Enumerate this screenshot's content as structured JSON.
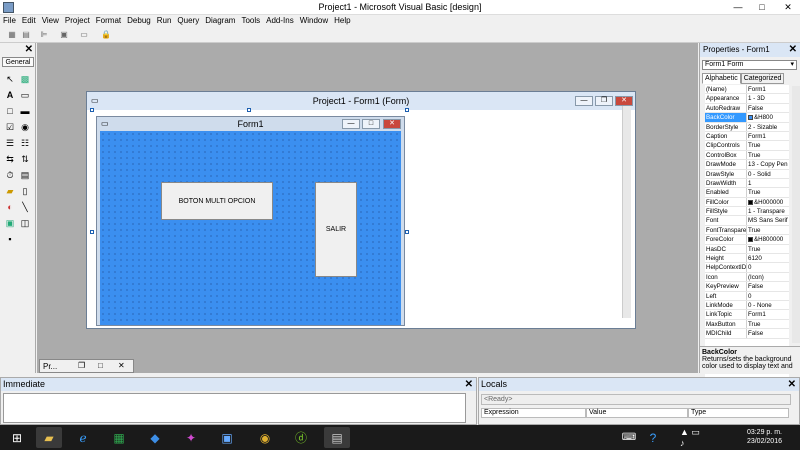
{
  "window": {
    "title": "Project1 - Microsoft Visual Basic [design]",
    "min": "—",
    "max": "□",
    "close": "✕"
  },
  "menu": [
    "File",
    "Edit",
    "View",
    "Project",
    "Format",
    "Debug",
    "Run",
    "Query",
    "Diagram",
    "Tools",
    "Add-Ins",
    "Window",
    "Help"
  ],
  "toolbox": {
    "close": "✕",
    "tab_label": "General"
  },
  "mdi_window": {
    "title": "Project1 - Form1 (Form)"
  },
  "form": {
    "caption": "Form1",
    "buttons": {
      "multi": "BOTON MULTI OPCION",
      "exit": "SALIR"
    }
  },
  "project_tab": {
    "label": "Pr..."
  },
  "properties": {
    "title": "Properties - Form1",
    "close": "✕",
    "object": "Form1  Form",
    "tabs": [
      "Alphabetic",
      "Categorized"
    ],
    "rows": [
      {
        "name": "(Name)",
        "value": "Form1"
      },
      {
        "name": "Appearance",
        "value": "1 - 3D"
      },
      {
        "name": "AutoRedraw",
        "value": "False"
      },
      {
        "name": "BackColor",
        "value": "&H800",
        "swatch": "#3b8ff0",
        "selected": true
      },
      {
        "name": "BorderStyle",
        "value": "2 - Sizable"
      },
      {
        "name": "Caption",
        "value": "Form1"
      },
      {
        "name": "ClipControls",
        "value": "True"
      },
      {
        "name": "ControlBox",
        "value": "True"
      },
      {
        "name": "DrawMode",
        "value": "13 - Copy Pen"
      },
      {
        "name": "DrawStyle",
        "value": "0 - Solid"
      },
      {
        "name": "DrawWidth",
        "value": "1"
      },
      {
        "name": "Enabled",
        "value": "True"
      },
      {
        "name": "FillColor",
        "value": "&H000000",
        "swatch": "#000000"
      },
      {
        "name": "FillStyle",
        "value": "1 - Transpare"
      },
      {
        "name": "Font",
        "value": "MS Sans Serif"
      },
      {
        "name": "FontTranspare",
        "value": "True"
      },
      {
        "name": "ForeColor",
        "value": "&H800000",
        "swatch": "#000000"
      },
      {
        "name": "HasDC",
        "value": "True"
      },
      {
        "name": "Height",
        "value": "6120"
      },
      {
        "name": "HelpContextID",
        "value": "0"
      },
      {
        "name": "Icon",
        "value": "(Icon)"
      },
      {
        "name": "KeyPreview",
        "value": "False"
      },
      {
        "name": "Left",
        "value": "0"
      },
      {
        "name": "LinkMode",
        "value": "0 - None"
      },
      {
        "name": "LinkTopic",
        "value": "Form1"
      },
      {
        "name": "MaxButton",
        "value": "True"
      },
      {
        "name": "MDIChild",
        "value": "False"
      }
    ],
    "desc_title": "BackColor",
    "desc_text": "Returns/sets the background color used to display text and"
  },
  "immediate": {
    "title": "Immediate",
    "close": "✕"
  },
  "locals": {
    "title": "Locals",
    "close": "✕",
    "status": "<Ready>",
    "columns": [
      "Expression",
      "Value",
      "Type"
    ]
  },
  "taskbar": {
    "time": "03:29 p. m.",
    "date": "23/02/2016"
  }
}
